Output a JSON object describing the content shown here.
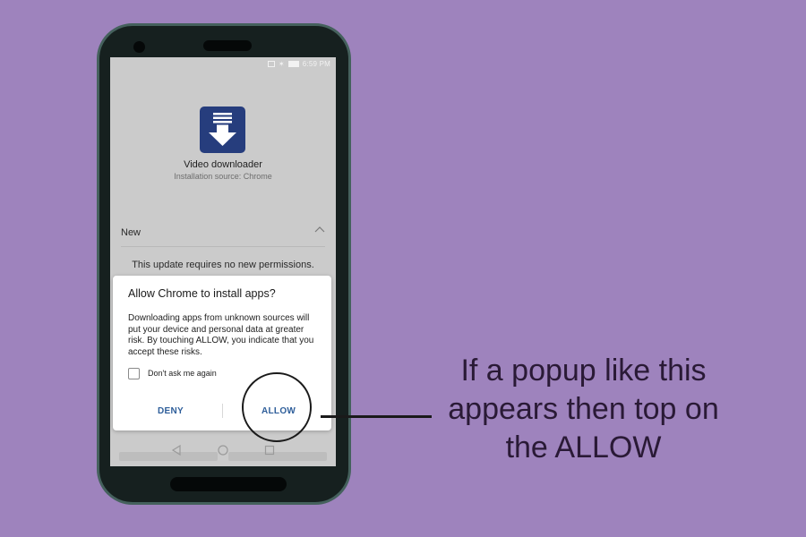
{
  "status_bar": {
    "time": "6:59 PM"
  },
  "app": {
    "name": "Video downloader",
    "source": "Installation source: Chrome",
    "icon": "download-arrow-icon"
  },
  "section": {
    "label": "New",
    "permissions_text": "This update requires no new permissions."
  },
  "dialog": {
    "title": "Allow Chrome to install apps?",
    "body": "Downloading apps from unknown sources will put your device and personal data at greater risk. By touching ALLOW, you indicate that you accept these risks.",
    "checkbox_label": "Don't ask me again",
    "deny_label": "DENY",
    "allow_label": "ALLOW"
  },
  "annotation": {
    "text": "If a popup like this appears then top on the ALLOW"
  },
  "colors": {
    "background": "#9e83bd",
    "app_icon": "#263d7d",
    "button_text": "#2e5e9a"
  }
}
